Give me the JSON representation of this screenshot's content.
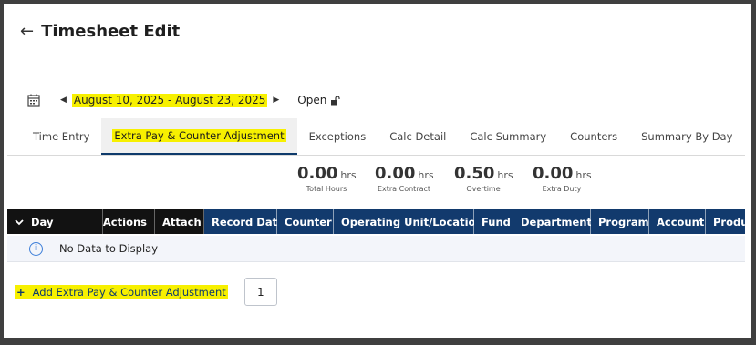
{
  "header": {
    "title": "Timesheet Edit",
    "back_icon": "arrow-left-icon"
  },
  "period": {
    "range": "August 10, 2025 - August 23, 2025",
    "status": "Open"
  },
  "tabs": [
    {
      "label": "Time Entry",
      "active": false
    },
    {
      "label": "Extra Pay & Counter Adjustment",
      "active": true
    },
    {
      "label": "Exceptions",
      "active": false
    },
    {
      "label": "Calc Detail",
      "active": false
    },
    {
      "label": "Calc Summary",
      "active": false
    },
    {
      "label": "Counters",
      "active": false
    },
    {
      "label": "Summary By Day",
      "active": false
    }
  ],
  "summary": [
    {
      "value": "0.00",
      "unit": "hrs",
      "label": "Total Hours"
    },
    {
      "value": "0.00",
      "unit": "hrs",
      "label": "Extra Contract"
    },
    {
      "value": "0.50",
      "unit": "hrs",
      "label": "Overtime"
    },
    {
      "value": "0.00",
      "unit": "hrs",
      "label": "Extra Duty"
    }
  ],
  "table": {
    "columns": [
      "Day",
      "Actions",
      "Attach",
      "Record Date",
      "Counter",
      "Operating Unit/Location",
      "Fund",
      "Department",
      "Program",
      "Account",
      "Produ"
    ],
    "empty_message": "No Data to Display"
  },
  "add": {
    "label": "Add Extra Pay & Counter Adjustment",
    "count": "1"
  },
  "colors": {
    "header_blue": "#123a6d",
    "header_black": "#121212",
    "highlight": "#f7f000"
  }
}
